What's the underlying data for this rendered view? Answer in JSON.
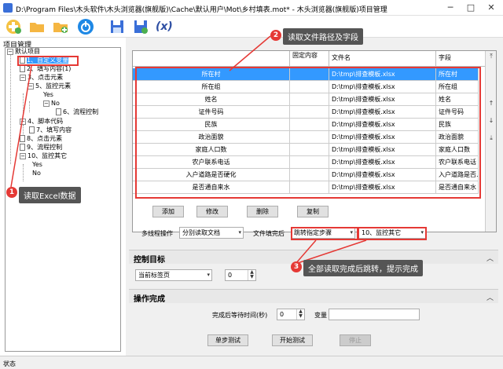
{
  "window": {
    "title": "D:\\Program Files\\木头软件\\木头浏览器(旗舰版)\\Cache\\默认用户\\Mot\\乡村填表.mot* - 木头浏览器(旗舰版)项目管理"
  },
  "toolbar": {
    "icons": [
      "new-project-icon",
      "open-folder-icon",
      "add-folder-icon",
      "power-icon",
      "save-icon",
      "save-as-icon",
      "variable-icon"
    ],
    "var_glyph": "(x)"
  },
  "left_panel": {
    "title": "项目管理"
  },
  "tree": {
    "root": "默认项目",
    "items": [
      "1、自定义变量",
      "2、填写内容(1)",
      "3、点击元素",
      "5、监控元素",
      "Yes",
      "No",
      "6、流程控制",
      "4、脚本代码",
      "7、填写内容",
      "8、点击元素",
      "9、流程控制",
      "10、监控其它",
      "Yes",
      "No"
    ]
  },
  "grid": {
    "headers": [
      "固定内容",
      "文件名",
      "字段"
    ],
    "rows": [
      {
        "name": "所在村",
        "file": "D:\\tmp\\排查模板.xlsx",
        "field": "所在村"
      },
      {
        "name": "所在组",
        "file": "D:\\tmp\\排查模板.xlsx",
        "field": "所在组"
      },
      {
        "name": "姓名",
        "file": "D:\\tmp\\排查模板.xlsx",
        "field": "姓名"
      },
      {
        "name": "证件号码",
        "file": "D:\\tmp\\排查模板.xlsx",
        "field": "证件号码"
      },
      {
        "name": "民族",
        "file": "D:\\tmp\\排查模板.xlsx",
        "field": "民族"
      },
      {
        "name": "政治面貌",
        "file": "D:\\tmp\\排查模板.xlsx",
        "field": "政治面貌"
      },
      {
        "name": "家庭人口数",
        "file": "D:\\tmp\\排查模板.xlsx",
        "field": "家庭人口数"
      },
      {
        "name": "农户联系电话",
        "file": "D:\\tmp\\排查模板.xlsx",
        "field": "农户联系电话"
      },
      {
        "name": "入户道路是否硬化",
        "file": "D:\\tmp\\排查模板.xlsx",
        "field": "入户道路是否..."
      },
      {
        "name": "是否通自来水",
        "file": "D:\\tmp\\排查模板.xlsx",
        "field": "是否通自来水"
      }
    ]
  },
  "buttons": {
    "add": "添加",
    "edit": "修改",
    "delete": "删除",
    "copy": "复制"
  },
  "options": {
    "thread_label": "多线程操作",
    "thread_value": "分别读取文档",
    "after_fill_label": "文件填完后",
    "after_fill_value": "跳转指定步骤",
    "target_step": "10、监控其它"
  },
  "control_target": {
    "title": "控制目标",
    "page_value": "当前标签页",
    "index_value": "0"
  },
  "finish": {
    "title": "操作完成",
    "wait_label": "完成后等待时间(秒)",
    "wait_value": "0",
    "var_label": "变量",
    "var_value": ""
  },
  "actions": {
    "step": "单步测试",
    "start": "开始测试",
    "stop": "停止"
  },
  "status": {
    "text": "状态"
  },
  "callouts": {
    "c1": {
      "num": "1",
      "text": "读取Excel数据"
    },
    "c2": {
      "num": "2",
      "text": "读取文件路径及字段"
    },
    "c3": {
      "num": "3",
      "text": "全部读取完成后跳转，提示完成"
    }
  },
  "colors": {
    "selection": "#3399ff",
    "callout_red": "#e53935",
    "callout_bg": "#555555"
  }
}
